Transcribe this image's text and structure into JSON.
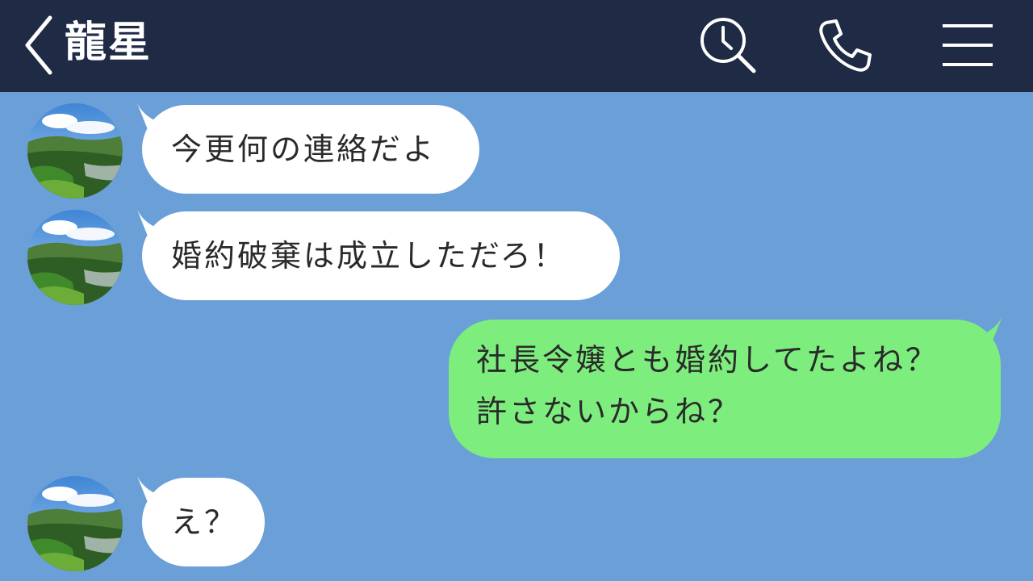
{
  "header": {
    "title": "龍星",
    "back_icon": "chevron-left-icon",
    "search_icon": "search-history-icon",
    "call_icon": "phone-icon",
    "menu_icon": "menu-icon"
  },
  "colors": {
    "header_bg": "#1f2a45",
    "chat_bg": "#6a9fd8",
    "incoming_bubble": "#ffffff",
    "outgoing_bubble": "#7ded7d"
  },
  "messages": [
    {
      "direction": "incoming",
      "text": "今更何の連絡だよ"
    },
    {
      "direction": "incoming",
      "text": "婚約破棄は成立しただろ！"
    },
    {
      "direction": "outgoing",
      "lines": [
        "社長令嬢とも婚約してたよね？",
        "許さないからね？"
      ]
    },
    {
      "direction": "incoming",
      "text": "え？"
    }
  ]
}
